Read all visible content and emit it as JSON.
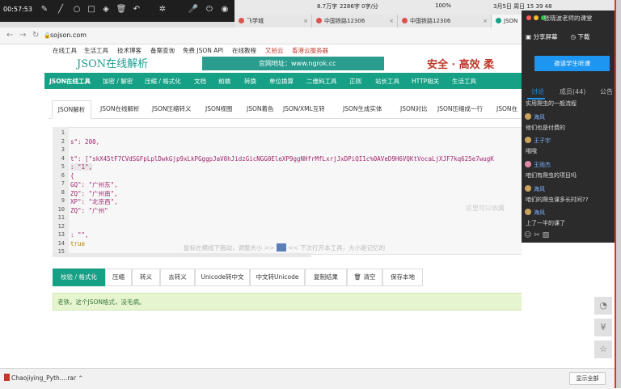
{
  "menubar": {
    "stats": "8.7万字",
    "count": "2286字",
    "rate": "0字/分",
    "battery": "100%",
    "datetime": "3月5日 周日 15 39 48"
  },
  "recorder": {
    "timer": "00:57:53"
  },
  "browser": {
    "tabs": [
      {
        "label": "飞学城"
      },
      {
        "label": "中国铁路12306"
      },
      {
        "label": "中国铁路12306"
      },
      {
        "label": "JSON"
      }
    ],
    "url": "sojson.com"
  },
  "site": {
    "toplinks": [
      "在线工具",
      "生活工具",
      "技术博客",
      "备案查询",
      "免费 JSON API",
      "在线教程",
      "又拍云",
      "香港云服务器"
    ],
    "logo": "JSON在线解析",
    "banner": "官网地址：www.ngrok.cc",
    "slogan": "安全 · 高效  柔",
    "nav": [
      "JSON在线工具",
      "加密 / 解密",
      "压缩 / 格式化",
      "文档",
      "前端",
      "转换",
      "单位换算",
      "二维码工具",
      "正则",
      "站长工具",
      "HTTP相关",
      "生活工具"
    ],
    "tool_tabs": [
      "JSON解析",
      "JSON在线解析",
      "JSON压缩转义",
      "JSON视图",
      "JSON着色",
      "JSON/XML互转",
      "JSON生成实体",
      "JSON对比",
      "JSON压缩成一行",
      "JSON在"
    ]
  },
  "editor": {
    "lines": [
      {
        "n": "1",
        "t": ""
      },
      {
        "n": "2",
        "t": "s\": 200,"
      },
      {
        "n": "3",
        "t": ""
      },
      {
        "n": "4",
        "t": "t\": [\"skX45tF7CVdSGFpLplDwkGjp9xLkPGggpJaV0hJidzGicNGG0EleXP9ggNHfrMfLxrjJxDPiQI1c%0AVeD9H6VQKtVocaLjXJF7kq625e7wugK"
      },
      {
        "n": "5",
        "t": ": \"1\","
      },
      {
        "n": "6",
        "t": "{"
      },
      {
        "n": "7",
        "t": "GQ\": \"广州东\","
      },
      {
        "n": "8",
        "t": "ZQ\": \"广州南\","
      },
      {
        "n": "9",
        "t": "XP\": \"北京西\","
      },
      {
        "n": "10",
        "t": "ZQ\": \"广州\""
      },
      {
        "n": "11",
        "t": ""
      },
      {
        "n": "12",
        "t": ""
      },
      {
        "n": "13",
        "t": ": \"\","
      },
      {
        "n": "14",
        "t": "true"
      },
      {
        "n": "15",
        "t": ""
      }
    ],
    "hint_drag": "鼠标在横线下拖动，调整大小 >> ",
    "hint_fullscreen": "<< 下次打开本工具，大小是记忆的",
    "hint_right": "这里可以收藏"
  },
  "actions": [
    "校验 / 格式化",
    "压缩",
    "转义",
    "去转义",
    "Unicode转中文",
    "中文转Unicode",
    "复制结果",
    "清空",
    "保存本地"
  ],
  "result": "老铁，这个JSON格式，没毛病。",
  "panel": {
    "title": "张晓波老师的课堂",
    "share": "分享屏幕",
    "download": "下载",
    "invite": "邀请学生听课",
    "tabs": [
      "讨论",
      "成员(44)",
      "公告"
    ],
    "messages": [
      {
        "name": "",
        "text": "实用爬虫的一般流程"
      },
      {
        "name": "海风",
        "text": "他们也是付费的"
      },
      {
        "name": "王子宇",
        "text": "哦哦"
      },
      {
        "name": "王雨杰",
        "text": "咱们有爬虫的项目吗"
      },
      {
        "name": "海风",
        "text": "咱们的爬虫课多长时间??"
      },
      {
        "name": "海风",
        "text": "上了一半的课了"
      }
    ]
  },
  "download_bar": {
    "file": "Chaojiying_Pyth....rar",
    "show_all": "显示全部"
  }
}
